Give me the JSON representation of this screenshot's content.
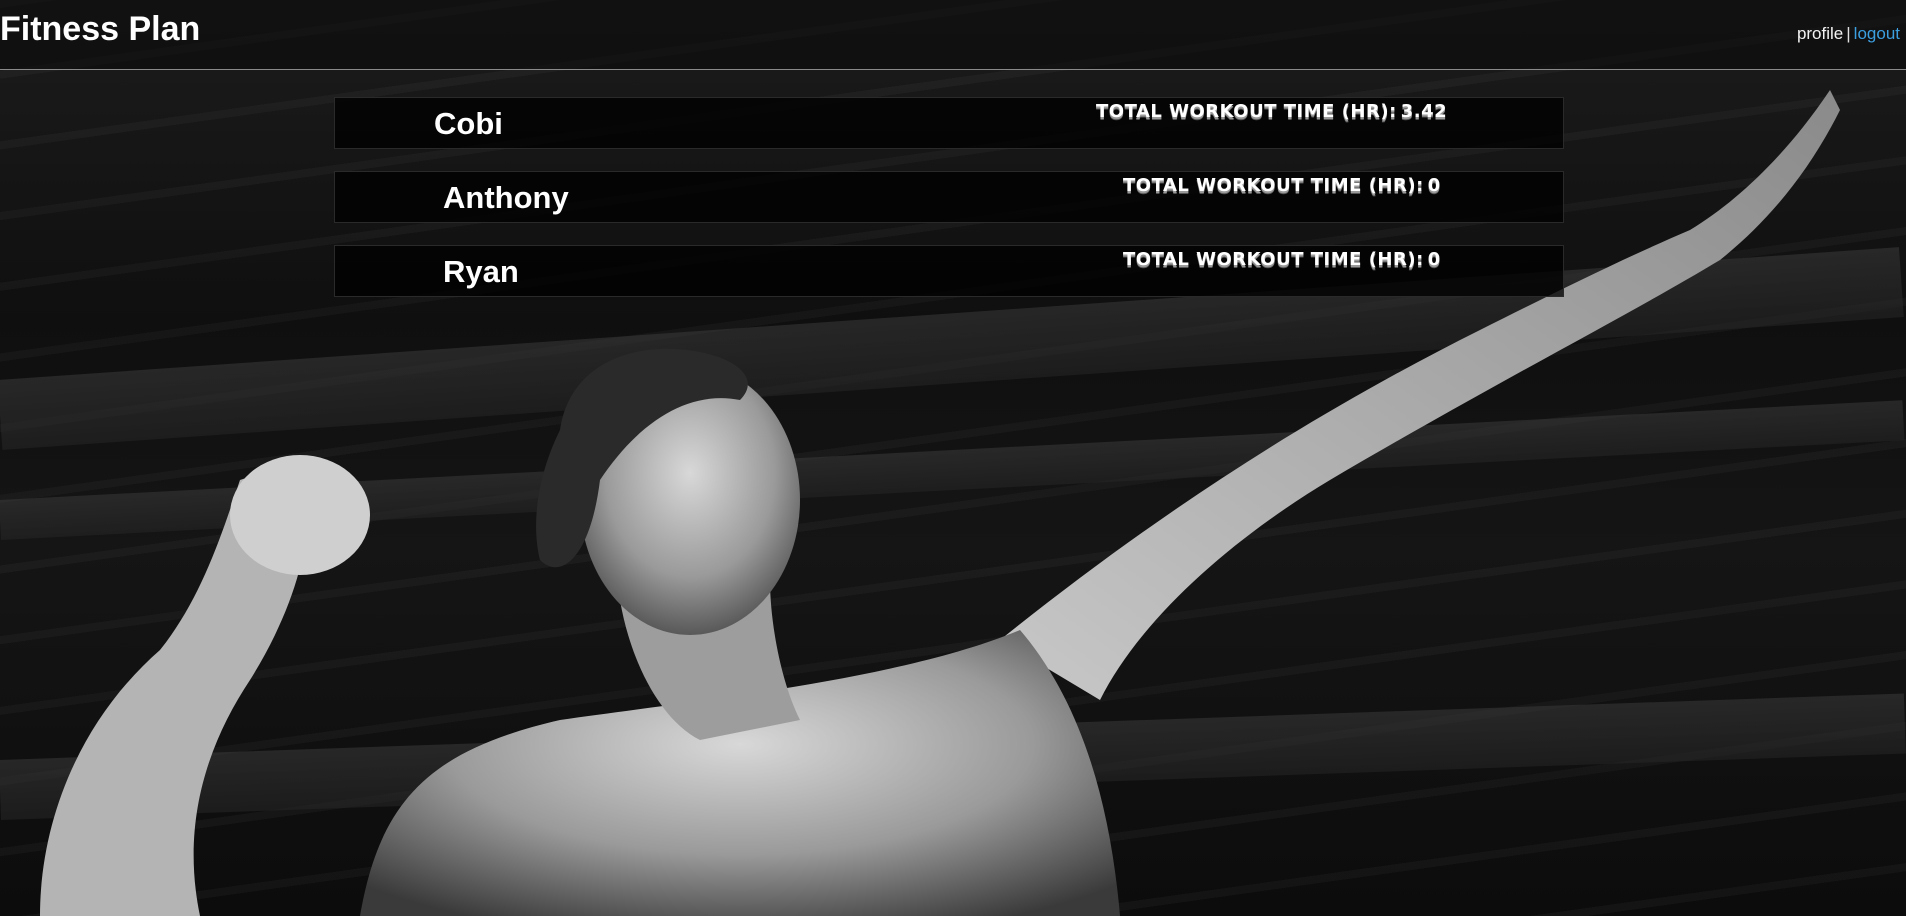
{
  "header": {
    "title": "Fitness Plan",
    "nav": {
      "profile_label": "profile",
      "separator": "|",
      "logout_label": "logout"
    }
  },
  "members": [
    {
      "name": "Cobi",
      "stat_label": "TOTAL WORKOUT TIME (HR):",
      "stat_value": "3.42"
    },
    {
      "name": "Anthony",
      "stat_label": "TOTAL WORKOUT TIME (HR):",
      "stat_value": "0"
    },
    {
      "name": "Ryan",
      "stat_label": "TOTAL WORKOUT TIME (HR):",
      "stat_value": "0"
    }
  ],
  "colors": {
    "link": "#3c9fe0",
    "background": "#111111",
    "row_background": "#000000"
  },
  "background_image": "black-and-white bodybuilder flexing photo"
}
